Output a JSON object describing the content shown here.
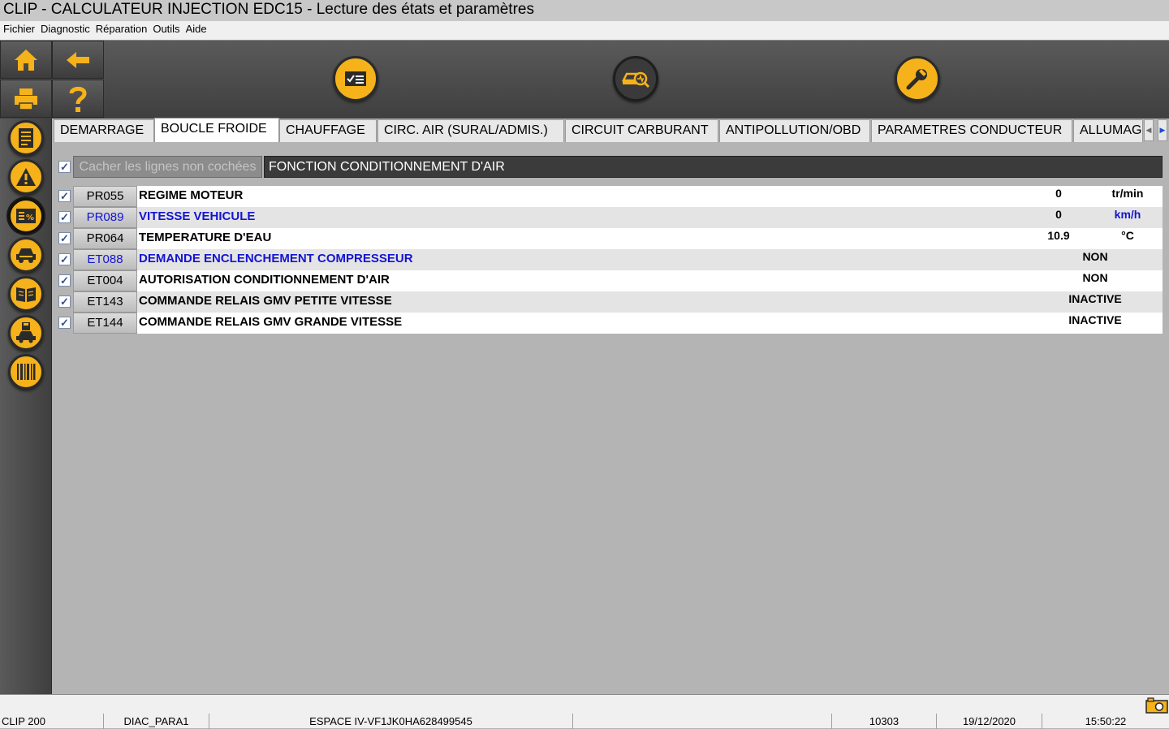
{
  "window": {
    "title": "CLIP - CALCULATEUR INJECTION EDC15 - Lecture des états et paramètres"
  },
  "menu": [
    "Fichier",
    "Diagnostic",
    "Réparation",
    "Outils",
    "Aide"
  ],
  "toolbar": {
    "left_icons": [
      "home-icon",
      "back-arrow-icon",
      "printer-icon",
      "help-icon"
    ],
    "center_icons": [
      "checklist-icon",
      "vehicle-diagnostic-icon",
      "wrench-icon"
    ]
  },
  "sidebar": {
    "icons": [
      "document-list-icon",
      "warning-icon",
      "parameters-icon",
      "vehicle-icon",
      "manual-book-icon",
      "save-vehicle-icon",
      "barcode-icon"
    ],
    "active_index": 2
  },
  "tabs": [
    "DEMARRAGE",
    "BOUCLE FROIDE",
    "CHAUFFAGE",
    "CIRC. AIR (SURAL/ADMIS.)",
    "CIRCUIT CARBURANT",
    "ANTIPOLLUTION/OBD",
    "PARAMETRES CONDUCTEUR",
    "ALLUMAGE"
  ],
  "active_tab": 1,
  "filter": {
    "checked": true,
    "hide_label": "Cacher les lignes non cochées",
    "section_title": "FONCTION CONDITIONNEMENT D'AIR"
  },
  "rows": [
    {
      "code": "PR055",
      "label": "REGIME MOTEUR",
      "value": "0",
      "unit": "tr/min",
      "checked": true,
      "highlight": false
    },
    {
      "code": "PR089",
      "label": "VITESSE VEHICULE",
      "value": "0",
      "unit": "km/h",
      "checked": true,
      "highlight": true
    },
    {
      "code": "PR064",
      "label": "TEMPERATURE D'EAU",
      "value": "10.9",
      "unit": "°C",
      "checked": true,
      "highlight": false
    },
    {
      "code": "ET088",
      "label": "DEMANDE ENCLENCHEMENT COMPRESSEUR",
      "state": "NON",
      "checked": true,
      "highlight": true
    },
    {
      "code": "ET004",
      "label": "AUTORISATION CONDITIONNEMENT D'AIR",
      "state": "NON",
      "checked": true,
      "highlight": false
    },
    {
      "code": "ET143",
      "label": "COMMANDE RELAIS GMV PETITE VITESSE",
      "state": "INACTIVE",
      "checked": true,
      "highlight": false
    },
    {
      "code": "ET144",
      "label": "COMMANDE RELAIS GMV GRANDE VITESSE",
      "state": "INACTIVE",
      "checked": true,
      "highlight": false
    }
  ],
  "status": {
    "app": "CLIP 200",
    "session": "DIAC_PARA1",
    "vehicle": "ESPACE IV-VF1JK0HA628499545",
    "blank": "",
    "code": "10303",
    "date": "19/12/2020",
    "time": "15:50:22"
  },
  "colors": {
    "accent": "#f5b21a",
    "highlight_text": "#1414d2",
    "toolbar": "#4a4a4a"
  }
}
